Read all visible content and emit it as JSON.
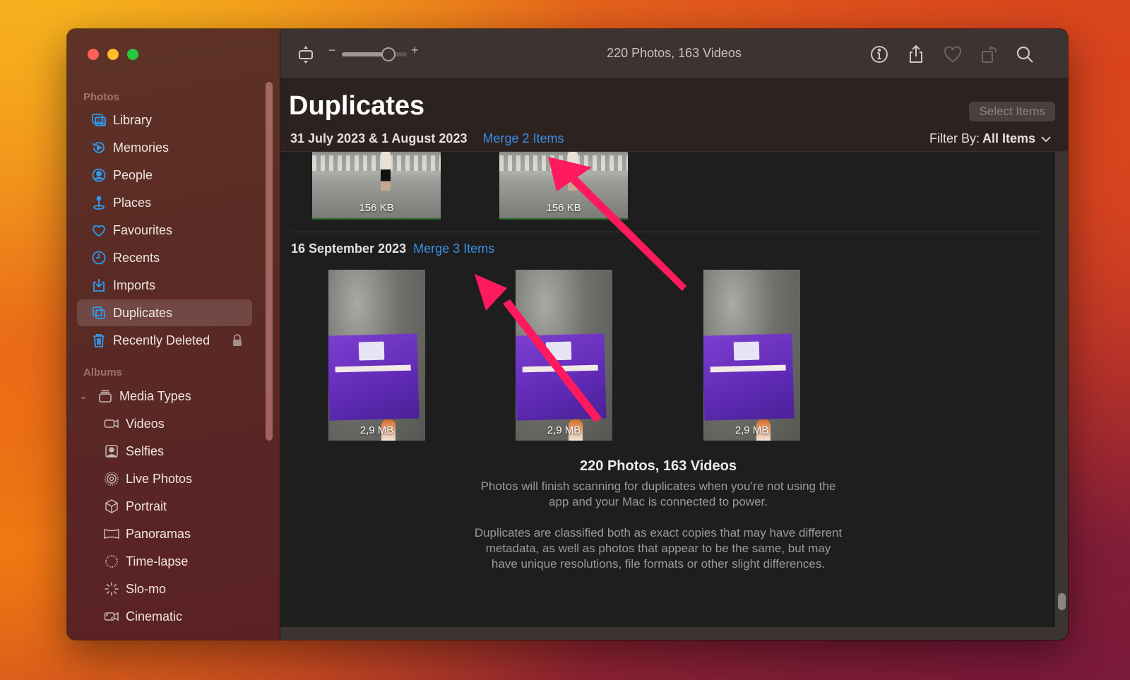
{
  "window": {
    "toolbar": {
      "title": "220 Photos, 163 Videos",
      "zoom_minus": "−",
      "zoom_plus": "+",
      "zoom_slider_value": 0.72,
      "icons": [
        "aspect-toggle-icon",
        "info-icon",
        "share-icon",
        "heart-icon",
        "rotate-icon",
        "search-icon"
      ]
    },
    "sidebar": {
      "sections": {
        "photos": "Photos",
        "albums": "Albums"
      },
      "items": [
        {
          "label": "Library",
          "icon": "library-icon"
        },
        {
          "label": "Memories",
          "icon": "memories-icon"
        },
        {
          "label": "People",
          "icon": "people-icon"
        },
        {
          "label": "Places",
          "icon": "places-icon"
        },
        {
          "label": "Favourites",
          "icon": "heart-icon"
        },
        {
          "label": "Recents",
          "icon": "clock-icon"
        },
        {
          "label": "Imports",
          "icon": "import-icon"
        },
        {
          "label": "Duplicates",
          "icon": "duplicates-icon",
          "selected": true
        },
        {
          "label": "Recently Deleted",
          "icon": "trash-icon",
          "locked": true
        }
      ],
      "album_group": {
        "label": "Media Types",
        "icon": "stack-icon",
        "expanded": true
      },
      "album_items": [
        {
          "label": "Videos",
          "icon": "video-icon"
        },
        {
          "label": "Selfies",
          "icon": "selfie-icon"
        },
        {
          "label": "Live Photos",
          "icon": "live-photo-icon"
        },
        {
          "label": "Portrait",
          "icon": "cube-icon"
        },
        {
          "label": "Panoramas",
          "icon": "panorama-icon"
        },
        {
          "label": "Time-lapse",
          "icon": "timelapse-icon"
        },
        {
          "label": "Slo-mo",
          "icon": "slomo-icon"
        },
        {
          "label": "Cinematic",
          "icon": "cinematic-icon"
        }
      ]
    },
    "header": {
      "title": "Duplicates",
      "select_button": "Select Items",
      "filter_label": "Filter By:",
      "filter_value": "All Items"
    },
    "groups": [
      {
        "date": "31 July 2023 & 1 August 2023",
        "merge_label": "Merge 2 Items",
        "items": [
          {
            "size": "156 KB"
          },
          {
            "size": "156 KB"
          }
        ]
      },
      {
        "date": "16 September 2023",
        "merge_label": "Merge 3 Items",
        "items": [
          {
            "size": "2,9 MB"
          },
          {
            "size": "2,9 MB"
          },
          {
            "size": "2,9 MB"
          }
        ]
      }
    ],
    "summary": {
      "title": "220 Photos, 163 Videos",
      "paragraph1": "Photos will finish scanning for duplicates when you’re not using the app and your Mac is connected to power.",
      "paragraph2": "Duplicates are classified both as exact copies that may have different metadata, as well as photos that appear to be the same, but may have unique resolutions, file formats or other slight differences."
    },
    "annotation_color": "#ff1a5e",
    "accent_color": "#3d8fe8"
  }
}
